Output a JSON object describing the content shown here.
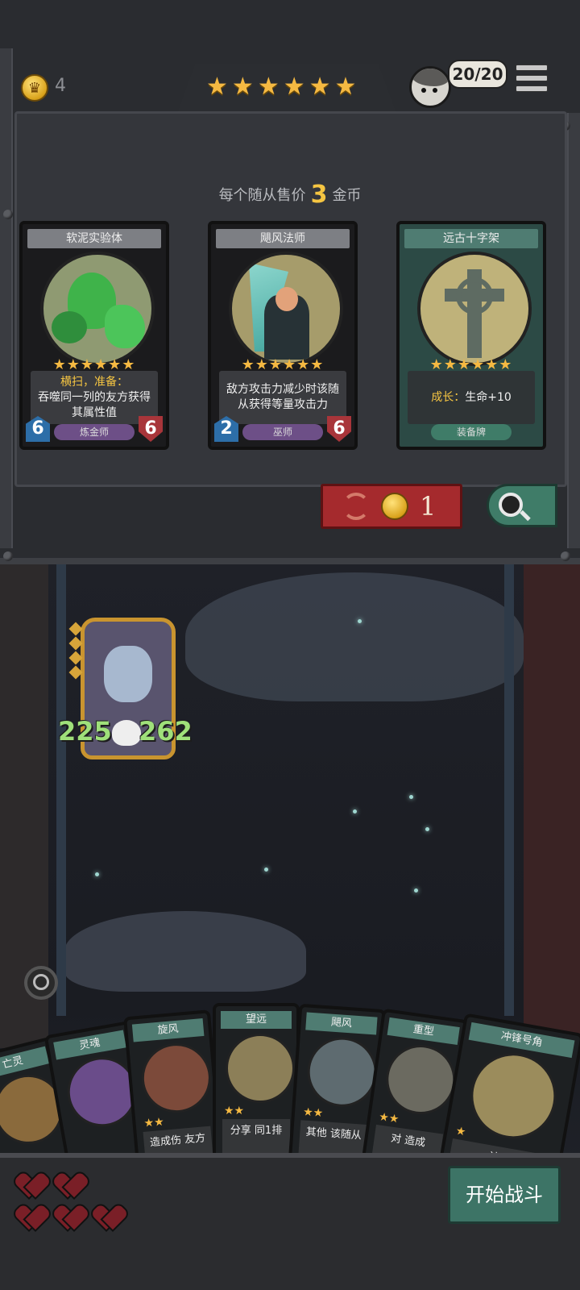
{
  "topbar": {
    "gold": "4",
    "star_count": 6,
    "army_count": "20/20",
    "icons": {
      "gold": "crown-coin-icon",
      "menu": "hamburger-menu-icon"
    }
  },
  "shop": {
    "sell_prefix": "每个随从售价",
    "sell_price": "3",
    "sell_suffix": "金币",
    "cards": [
      {
        "name": "软泥实验体",
        "stars": "★★★★★★",
        "desc_highlight": "横扫，准备：",
        "desc": "吞噬同一列的友方获得其属性值",
        "tribe": "炼金师",
        "attack": "6",
        "health": "6"
      },
      {
        "name": "飓风法师",
        "stars": "★★★★★★",
        "desc_highlight": "",
        "desc": "敌方攻击力减少时该随从获得等量攻击力",
        "tribe": "巫师",
        "attack": "2",
        "health": "6"
      },
      {
        "name": "远古十字架",
        "stars": "★★★★★★",
        "desc_highlight": "成长：",
        "desc": "生命+10",
        "tribe": "装备牌",
        "attack": "",
        "health": ""
      }
    ],
    "refresh_cost": "1"
  },
  "battle": {
    "hero": {
      "attack": "225",
      "health": "262"
    }
  },
  "hand": [
    {
      "name": "亡灵",
      "stars": "",
      "desc": ""
    },
    {
      "name": "灵魂",
      "stars": "",
      "desc": ""
    },
    {
      "name": "旋风",
      "stars": "★★",
      "desc": "造成伤 友方"
    },
    {
      "name": "望远",
      "stars": "★★",
      "desc": "分享 同1排"
    },
    {
      "name": "飓风",
      "stars": "★★",
      "desc": "其他 该随从"
    },
    {
      "name": "重型",
      "stars": "★★",
      "desc": "对 造成"
    },
    {
      "name": "冲锋号角",
      "stars": "★",
      "desc": "该 属"
    }
  ],
  "footer": {
    "lives": 5,
    "start_label": "开始战斗"
  }
}
